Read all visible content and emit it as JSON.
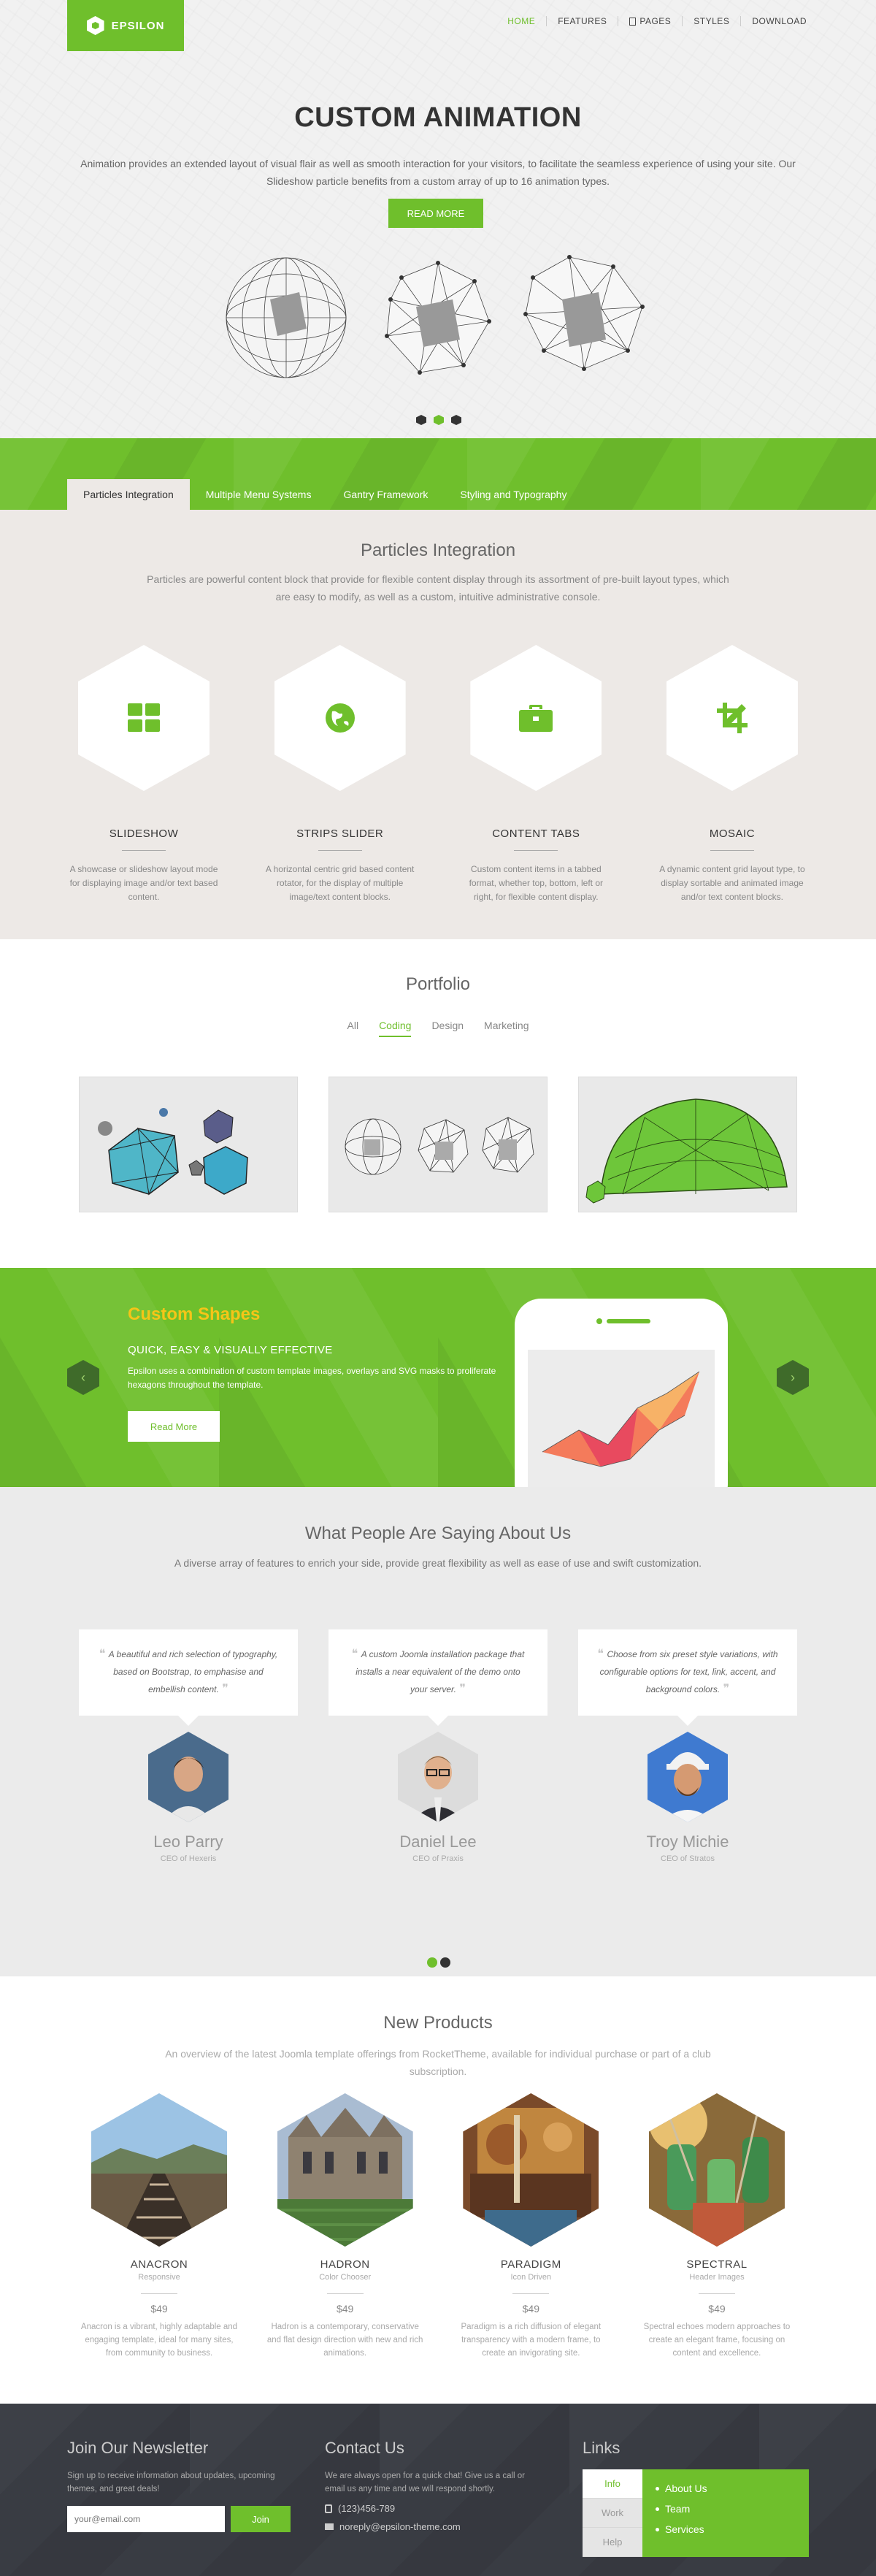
{
  "header": {
    "logo_text": "EPSILON",
    "nav": [
      {
        "label": "HOME",
        "active": true
      },
      {
        "label": "FEATURES"
      },
      {
        "label": "PAGES",
        "icon": "document-icon"
      },
      {
        "label": "STYLES"
      },
      {
        "label": "DOWNLOAD"
      }
    ]
  },
  "hero": {
    "title": "CUSTOM ANIMATION",
    "text": "Animation provides an extended layout of visual flair as well as smooth interaction for your visitors, to facilitate the seamless experience of using your site. Our Slideshow particle benefits from a custom array of up to 16 animation types.",
    "button": "READ MORE",
    "slides": 3,
    "active_slide": 2
  },
  "tabs": [
    "Particles Integration",
    "Multiple Menu Systems",
    "Gantry Framework",
    "Styling and Typography"
  ],
  "particles": {
    "title": "Particles Integration",
    "subtitle": "Particles are powerful content block that provide for flexible content display through its assortment of pre-built layout types, which are easy to modify, as well as a custom, intuitive administrative console.",
    "items": [
      {
        "name": "SLIDESHOW",
        "icon": "grid-icon",
        "desc": "A showcase or slideshow layout mode for displaying image and/or text based content."
      },
      {
        "name": "STRIPS SLIDER",
        "icon": "globe-icon",
        "desc": "A horizontal centric grid based content rotator, for the display of multiple image/text content blocks."
      },
      {
        "name": "CONTENT TABS",
        "icon": "briefcase-icon",
        "desc": "Custom content items in a tabbed format, whether top, bottom, left or right, for flexible content display."
      },
      {
        "name": "MOSAIC",
        "icon": "crop-icon",
        "desc": "A dynamic content grid layout type, to display sortable and animated image and/or text content blocks."
      }
    ]
  },
  "portfolio": {
    "title": "Portfolio",
    "filters": [
      {
        "label": "All"
      },
      {
        "label": "Coding",
        "active": true
      },
      {
        "label": "Design"
      },
      {
        "label": "Marketing"
      }
    ]
  },
  "shapes": {
    "title": "Custom Shapes",
    "subtitle": "QUICK, EASY & VISUALLY EFFECTIVE",
    "text": "Epsilon uses a combination of custom template images, overlays and SVG masks to proliferate hexagons throughout the template.",
    "button": "Read More"
  },
  "testimonials": {
    "title": "What People Are Saying About Us",
    "subtitle": "A diverse array of features to enrich your side, provide great flexibility as well as ease of use and swift customization.",
    "items": [
      {
        "quote": "A beautiful and rich selection of typography, based on Bootstrap, to emphasise and embellish content.",
        "name": "Leo Parry",
        "role": "CEO of Hexeris"
      },
      {
        "quote": "A custom Joomla installation package that installs a near equivalent of the demo onto your server.",
        "name": "Daniel Lee",
        "role": "CEO of Praxis"
      },
      {
        "quote": "Choose from six preset style variations, with configurable options for text, link, accent, and background colors.",
        "name": "Troy Michie",
        "role": "CEO of Stratos"
      }
    ]
  },
  "products": {
    "title": "New Products",
    "subtitle": "An overview of the latest Joomla template offerings from RocketTheme, available for individual purchase or part of a club subscription.",
    "items": [
      {
        "name": "ANACRON",
        "tag": "Responsive",
        "price": "$49",
        "desc": "Anacron is a vibrant, highly adaptable and engaging template, ideal for many sites, from community to business."
      },
      {
        "name": "HADRON",
        "tag": "Color Chooser",
        "price": "$49",
        "desc": "Hadron is a contemporary, conservative and flat design direction with new and rich animations."
      },
      {
        "name": "PARADIGM",
        "tag": "Icon Driven",
        "price": "$49",
        "desc": "Paradigm is a rich diffusion of elegant transparency with a modern frame, to create an invigorating site."
      },
      {
        "name": "SPECTRAL",
        "tag": "Header Images",
        "price": "$49",
        "desc": "Spectral echoes modern approaches to create an elegant frame, focusing on content and excellence."
      }
    ]
  },
  "footer": {
    "newsletter": {
      "title": "Join Our Newsletter",
      "text": "Sign up to receive information about updates, upcoming themes, and great deals!",
      "placeholder": "your@email.com",
      "button": "Join"
    },
    "contact": {
      "title": "Contact Us",
      "text": "We are always open for a quick chat! Give us a call or email us any time and we will respond shortly.",
      "phone": "(123)456-789",
      "email": "noreply@epsilon-theme.com"
    },
    "links": {
      "title": "Links",
      "tabs": [
        {
          "label": "Info",
          "active": true
        },
        {
          "label": "Work"
        },
        {
          "label": "Help"
        }
      ],
      "items": [
        "About Us",
        "Team",
        "Services"
      ]
    }
  },
  "colors": {
    "accent": "#6fbf2c",
    "shapes_title": "#f5c518",
    "footer_bg": "#393c43"
  }
}
